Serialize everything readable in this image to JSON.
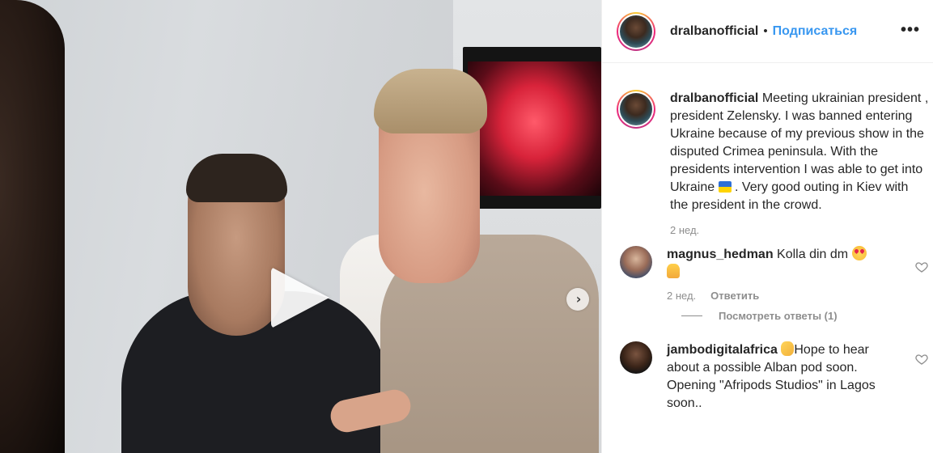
{
  "post": {
    "author": "dralbanofficial",
    "follow_label": "Подписаться",
    "separator": "•",
    "more_label": "•••"
  },
  "media": {
    "type": "video",
    "play_icon": "play-icon",
    "next_icon": "chevron-right-icon"
  },
  "caption": {
    "username": "dralbanofficial",
    "text_before_flag": "Meeting ukrainian president , president Zelensky. I was banned entering Ukraine because of my previous show in the disputed Crimea peninsula. With the presidents intervention I was able to get into Ukraine",
    "text_after_flag": " . Very good outing in Kiev with the president in the crowd.",
    "time": "2 нед."
  },
  "comments": [
    {
      "username": "magnus_hedman",
      "text": "Kolla din dm",
      "time": "2 нед.",
      "reply_label": "Ответить",
      "view_replies": "Посмотреть ответы (1)"
    },
    {
      "username": "jambodigitalafrica",
      "text": "Hope to hear about a possible Alban pod soon. Opening \"Afripods Studios\" in Lagos soon.."
    }
  ],
  "colors": {
    "follow_blue": "#3897f0",
    "meta_gray": "#8e8e8e",
    "text": "#262626"
  }
}
